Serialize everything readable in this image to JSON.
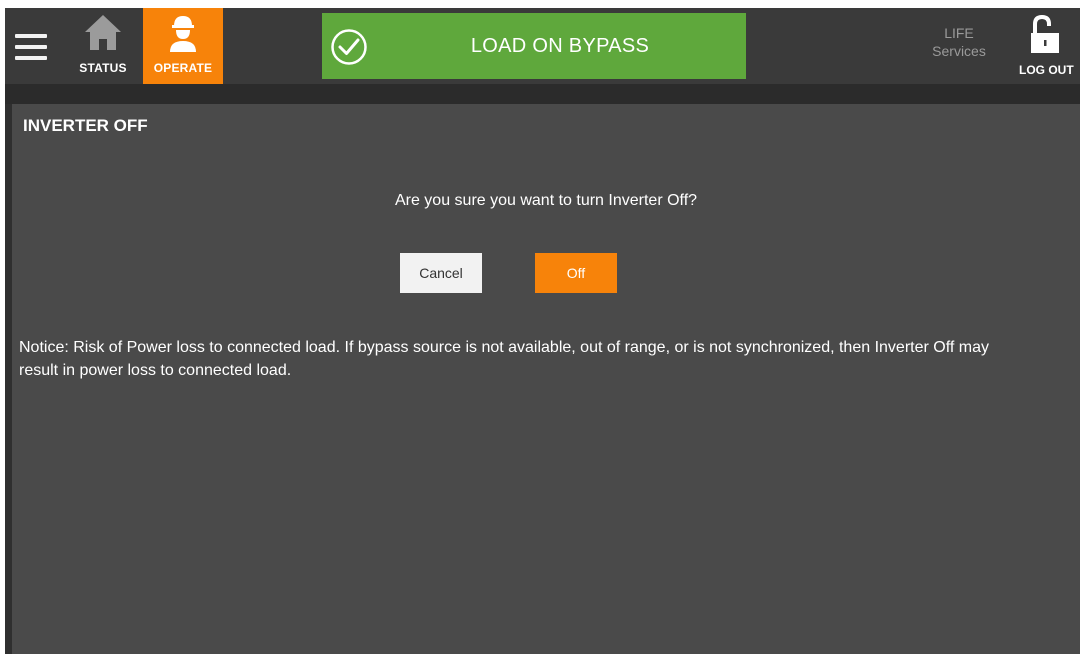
{
  "header": {
    "nav": [
      {
        "id": "status",
        "label": "STATUS",
        "icon": "home-icon"
      },
      {
        "id": "operate",
        "label": "OPERATE",
        "icon": "operator-icon",
        "active": true
      }
    ],
    "status_banner": {
      "text": "LOAD ON BYPASS",
      "icon": "check-circle-icon",
      "color": "#5fa83c"
    },
    "life_services": {
      "line1": "LIFE",
      "line2": "Services"
    },
    "logout": {
      "label": "LOG OUT",
      "icon": "unlocked-padlock-icon"
    }
  },
  "panel": {
    "title": "INVERTER OFF",
    "question": "Are you sure you want to turn Inverter Off?",
    "buttons": {
      "cancel": "Cancel",
      "off": "Off"
    },
    "notice": "Notice: Risk of Power loss to connected load. If bypass source is not available, out of range, or is not synchronized, then Inverter Off may result in power loss to connected load."
  },
  "colors": {
    "accent": "#f7830a",
    "ok": "#5fa83c",
    "panel": "#4a4a4a",
    "bar": "#3a3a3a"
  }
}
